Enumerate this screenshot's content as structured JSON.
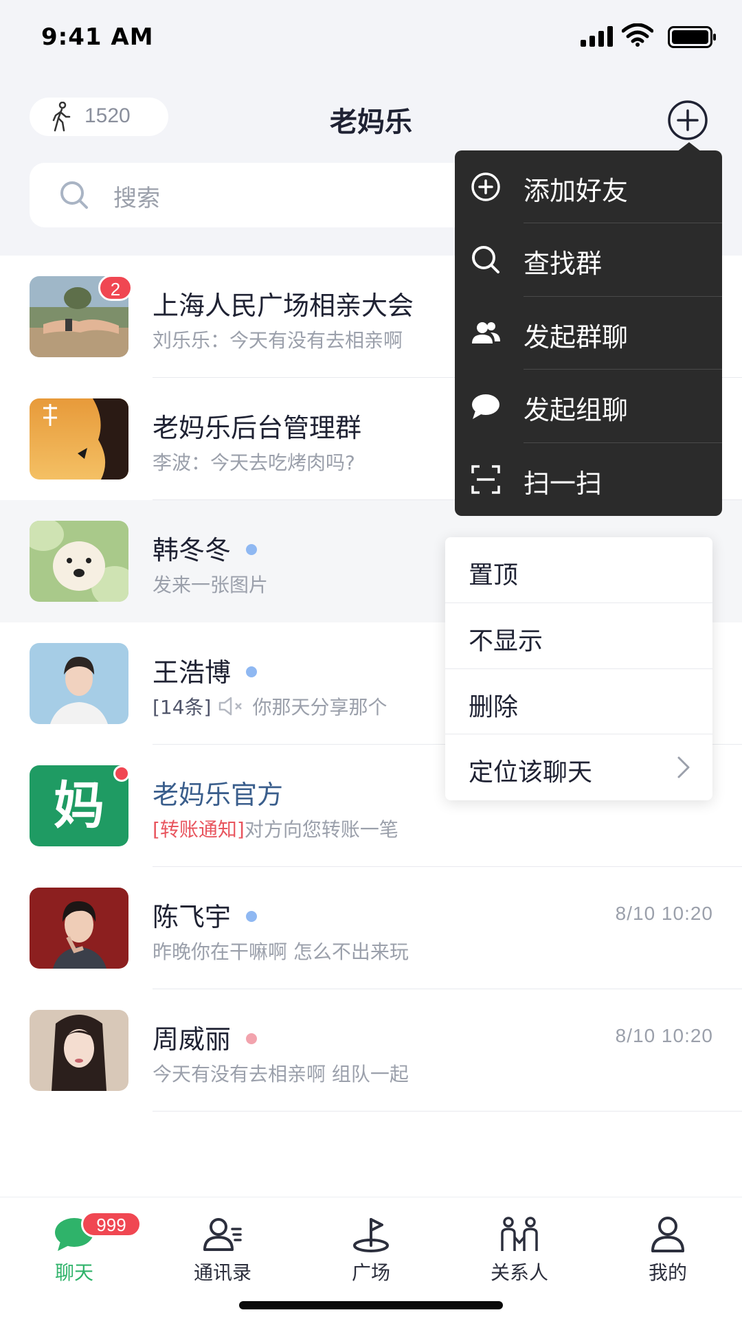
{
  "status_bar": {
    "time": "9:41 AM"
  },
  "header": {
    "steps": "1520",
    "title": "老妈乐",
    "search_placeholder": "搜索"
  },
  "colors": {
    "accent_green": "#2fb36a",
    "badge_red": "#f04752",
    "online_blue": "#8fb8f2",
    "online_pink": "#f2a3ad",
    "menu_dark": "#2b2b2b"
  },
  "chats": [
    {
      "name": "上海人民广场相亲大会",
      "preview": "刘乐乐：今天有没有去相亲啊",
      "badge": "2",
      "time": "",
      "avatar": "holding-hands-photo"
    },
    {
      "name": "老妈乐后台管理群",
      "preview": "李波：今天去吃烤肉吗?",
      "badge": "",
      "time": "",
      "avatar": "climber-poster"
    },
    {
      "name": "韩冬冬",
      "preview": "发来一张图片",
      "badge": "",
      "time": "",
      "avatar": "dog-in-cabbage-photo"
    },
    {
      "name": "王浩博",
      "preview_prefix": "[14条]",
      "preview": "你那天分享那个",
      "badge": "",
      "time": "",
      "avatar": "young-man-photo"
    },
    {
      "name": "老妈乐官方",
      "preview_tag": "[转账通知]",
      "preview": "对方向您转账一笔",
      "badge": "",
      "time": "",
      "avatar": "ma-logo",
      "avatar_text": "妈"
    },
    {
      "name": "陈飞宇",
      "preview": "昨晚你在干嘛啊 怎么不出来玩",
      "badge": "",
      "time": "8/10 10:20",
      "avatar": "actor-photo"
    },
    {
      "name": "周威丽",
      "preview": "今天有没有去相亲啊 组队一起",
      "badge": "",
      "time": "8/10 10:20",
      "avatar": "young-woman-photo"
    }
  ],
  "plus_menu": [
    {
      "label": "添加好友",
      "icon": "add-circle-icon"
    },
    {
      "label": "查找群",
      "icon": "search-icon"
    },
    {
      "label": "发起群聊",
      "icon": "group-icon"
    },
    {
      "label": "发起组聊",
      "icon": "chat-bubble-icon"
    },
    {
      "label": "扫一扫",
      "icon": "scan-icon"
    }
  ],
  "context_menu": [
    {
      "label": "置顶"
    },
    {
      "label": "不显示"
    },
    {
      "label": "删除"
    },
    {
      "label": "定位该聊天"
    }
  ],
  "tabs": [
    {
      "label": "聊天",
      "icon": "chat-icon",
      "badge": "999",
      "active": true
    },
    {
      "label": "通讯录",
      "icon": "contacts-icon"
    },
    {
      "label": "广场",
      "icon": "plaza-icon"
    },
    {
      "label": "关系人",
      "icon": "relations-icon"
    },
    {
      "label": "我的",
      "icon": "profile-icon"
    }
  ]
}
